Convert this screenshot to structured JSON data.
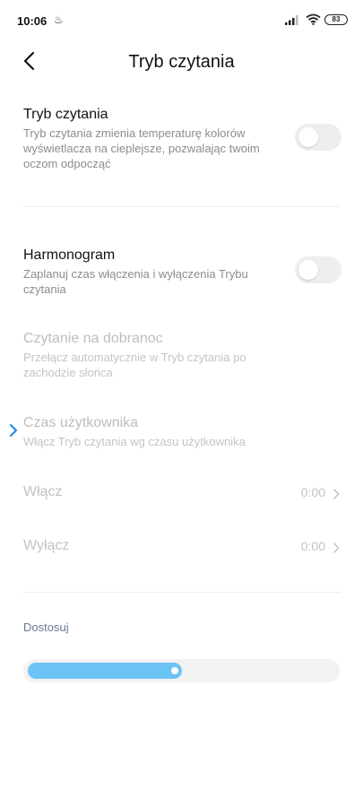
{
  "status": {
    "time": "10:06",
    "notification_glyph": "♨",
    "battery": "83"
  },
  "header": {
    "title": "Tryb czytania",
    "back_icon": "chevron-left"
  },
  "reading_mode": {
    "title": "Tryb czytania",
    "description": "Tryb czytania zmienia temperaturę kolorów wyświetlacza na cieplejsze, pozwalając twoim oczom odpocząć",
    "enabled": false
  },
  "schedule": {
    "title": "Harmonogram",
    "description": "Zaplanuj czas włączenia i wyłączenia Trybu czytania",
    "enabled": false
  },
  "bedtime": {
    "title": "Czytanie na dobranoc",
    "description": "Przełącz automatycznie w Tryb czytania po zachodzie słońca"
  },
  "custom_time": {
    "title": "Czas użytkownika",
    "description": "Włącz Tryb czytania wg czasu użytkownika"
  },
  "turn_on": {
    "label": "Włącz",
    "value": "0:00"
  },
  "turn_off": {
    "label": "Wyłącz",
    "value": "0:00"
  },
  "adjust": {
    "label": "Dostosuj",
    "level": 0.5
  },
  "colors": {
    "accent": "#6cc3f5",
    "selected_indicator": "#1e88e5"
  }
}
